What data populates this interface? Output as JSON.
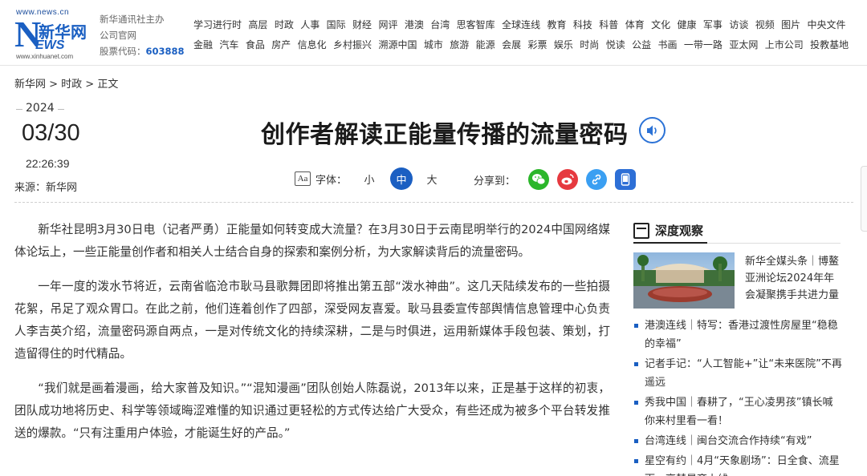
{
  "header": {
    "logo": {
      "url_top": "www.news.cn",
      "letter": "N",
      "name": "新华网",
      "ews": "EWS",
      "url_bottom": "www.xinhuanet.com"
    },
    "sponsor": {
      "line1": "新华通讯社主办",
      "line2": "公司官网",
      "stock_label": "股票代码：",
      "stock_code": "603888"
    },
    "nav_row1": [
      "学习进行时",
      "高层",
      "时政",
      "人事",
      "国际",
      "财经",
      "网评",
      "港澳",
      "台湾",
      "思客智库",
      "全球连线",
      "教育",
      "科技",
      "科普",
      "体育",
      "文化",
      "健康",
      "军事",
      "访谈",
      "视频",
      "图片",
      "中央文件"
    ],
    "nav_row2": [
      "金融",
      "汽车",
      "食品",
      "房产",
      "信息化",
      "乡村振兴",
      "溯源中国",
      "城市",
      "旅游",
      "能源",
      "会展",
      "彩票",
      "娱乐",
      "时尚",
      "悦读",
      "公益",
      "书画",
      "一带一路",
      "亚太网",
      "上市公司",
      "投教基地"
    ]
  },
  "breadcrumb": "新华网 > 时政 > 正文",
  "date": {
    "year": "2024",
    "day": "03/30",
    "time": "22:26:39"
  },
  "source": "来源：新华网",
  "title": "创作者解读正能量传播的流量密码",
  "font_controls": {
    "icon": "Aa",
    "label": "字体：",
    "small": "小",
    "medium": "中",
    "large": "大"
  },
  "share": {
    "label": "分享到：",
    "icons": [
      "wechat-icon",
      "weibo-icon",
      "link-icon",
      "mobile-icon"
    ]
  },
  "article": {
    "paragraphs": [
      "新华社昆明3月30日电（记者严勇）正能量如何转变成大流量？在3月30日于云南昆明举行的2024中国网络媒体论坛上，一些正能量创作者和相关人士结合自身的探索和案例分析，为大家解读背后的流量密码。",
      "一年一度的泼水节将近，云南省临沧市耿马县歌舞团即将推出第五部“泼水神曲”。这几天陆续发布的一些拍摄花絮，吊足了观众胃口。在此之前，他们连着创作了四部，深受网友喜爱。耿马县委宣传部舆情信息管理中心负责人李吉英介绍，流量密码源自两点，一是对传统文化的持续深耕，二是与时俱进，运用新媒体手段包装、策划，打造留得住的时代精品。",
      "“我们就是画着漫画，给大家普及知识。”“混知漫画”团队创始人陈磊说，2013年以来，正是基于这样的初衷，团队成功地将历史、科学等领域晦涩难懂的知识通过更轻松的方式传达给广大受众，有些还成为被多个平台转发推送的爆款。“只有注重用户体验，才能诞生好的产品。”"
    ]
  },
  "sidebar": {
    "title": "深度观察",
    "feature_text": "新华全媒头条｜博鳌亚洲论坛2024年年会凝聚携手共进力量",
    "items": [
      "港澳连线｜特写：香港过渡性房屋里“稳稳的幸福”",
      "记者手记：“人工智能+”让“未来医院”不再遥远",
      "秀我中国｜春耕了，“王心凌男孩”镇长喊你来村里看一看！",
      "台湾连线｜闽台交流合作持续“有戏”",
      "星空有约｜4月“天象剧场”：日全食、流星雨、亮彗星齐上线"
    ]
  },
  "colors": {
    "brand_blue": "#1a5fc2",
    "wechat": "#2bb62a",
    "weibo": "#e6393f",
    "link": "#3a9ff2",
    "mobile": "#2d6fd6"
  }
}
